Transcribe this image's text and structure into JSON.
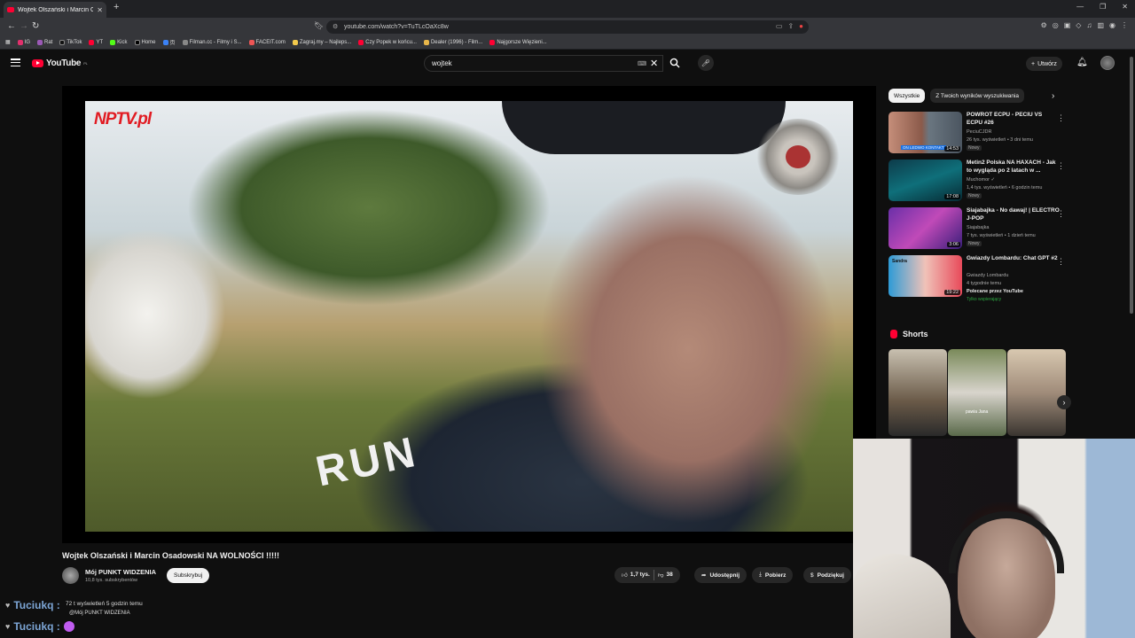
{
  "browser": {
    "tab_title": "Wojtek Olszański i Marcin Os",
    "url": "youtube.com/watch?v=TuTLcOaXc8w",
    "bookmarks": [
      "IG",
      "Rat",
      "TikTok",
      "YT",
      "Kick",
      "Home",
      "页",
      "Filman.cc - Filmy i S...",
      "FACEIT.com",
      "Zagraj.my – Najleps...",
      "Czy Popek w końcu...",
      "Dealer (1996) - Film...",
      "Najgorsze Więzieni..."
    ]
  },
  "youtube": {
    "logo_text": "YouTube",
    "region": "PL",
    "search_value": "wojtek",
    "create_label": "Utwórz"
  },
  "video": {
    "nptv_text": "NPTV.pl",
    "shirt_text": "RUN",
    "title": "Wojtek Olszański i Marcin Osadowski NA WOLNOŚCI !!!!!",
    "channel": "Mój PUNKT WIDZENIA",
    "subs": "10,8 tys. subskrybentów",
    "subscribe": "Subskrybuj",
    "likes": "1,7 tys.",
    "dislikes": "38",
    "share": "Udostępnij",
    "download": "Pobierz",
    "thanks": "Podziękuj"
  },
  "chat": [
    {
      "user": "Tuciukq :",
      "text": "72 t wyświetleń  5 godzin temu",
      "sub": "@Mój PUNKT WIDZENIA"
    },
    {
      "user": "Tuciukq :"
    }
  ],
  "sidebar": {
    "chips": [
      "Wszystkie",
      "Z Twoich wyników wyszukiwania"
    ],
    "recs": [
      {
        "title": "POWRÓT ECPU - PECIU VS ECPU #26",
        "channel": "PeciuCJDR",
        "meta": "26 tys. wyświetleń • 3 dni temu",
        "badge": "Nowy",
        "duration": "14:53",
        "thumb_label": "ON LEDWO KONTAKT"
      },
      {
        "title": "Metin2 Polska NA HAXACH - Jak to wygląda po 2 latach w ...",
        "channel": "Muchomor ✓",
        "meta": "1,4 tys. wyświetleń • 6 godzin temu",
        "badge": "Nowy",
        "duration": "17:08"
      },
      {
        "title": "Siajabajka - No dawaj! | ELECTRO J-POP",
        "channel": "Siajabajka",
        "meta": "7 tys. wyświetleń • 1 dzień temu",
        "badge": "Nowy",
        "duration": "3:06"
      },
      {
        "title": "Gwiazdy Lombardu: Chat GPT #2",
        "channel": "Gwiazdy Lombardu",
        "meta": "4 tygodnie temu",
        "sub_line": "Polecane przez YouTube",
        "member": "Tylko wspierający",
        "duration": "19:22",
        "thumb_label": "Sandra"
      }
    ],
    "shorts_label": "Shorts",
    "short_caption": "pawia Jana"
  },
  "colors": {
    "accent": "#ff0033",
    "bg": "#0f0f0f",
    "chat_name": "#7da6d6"
  }
}
